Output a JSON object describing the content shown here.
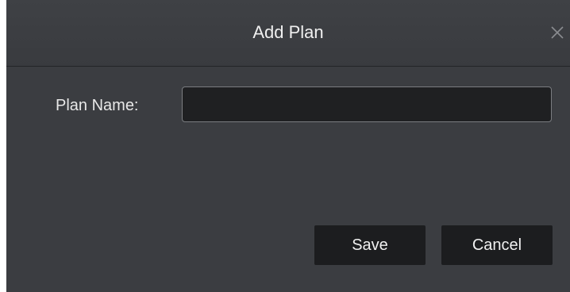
{
  "dialog": {
    "title": "Add Plan",
    "close_icon": "close-icon"
  },
  "form": {
    "plan_name_label": "Plan Name:",
    "plan_name_value": "",
    "plan_name_placeholder": ""
  },
  "buttons": {
    "save_label": "Save",
    "cancel_label": "Cancel"
  },
  "colors": {
    "dialog_background": "#3b3d41",
    "input_background": "#1f2022",
    "button_background": "#1c1d1f",
    "text": "#f0f0f0"
  }
}
